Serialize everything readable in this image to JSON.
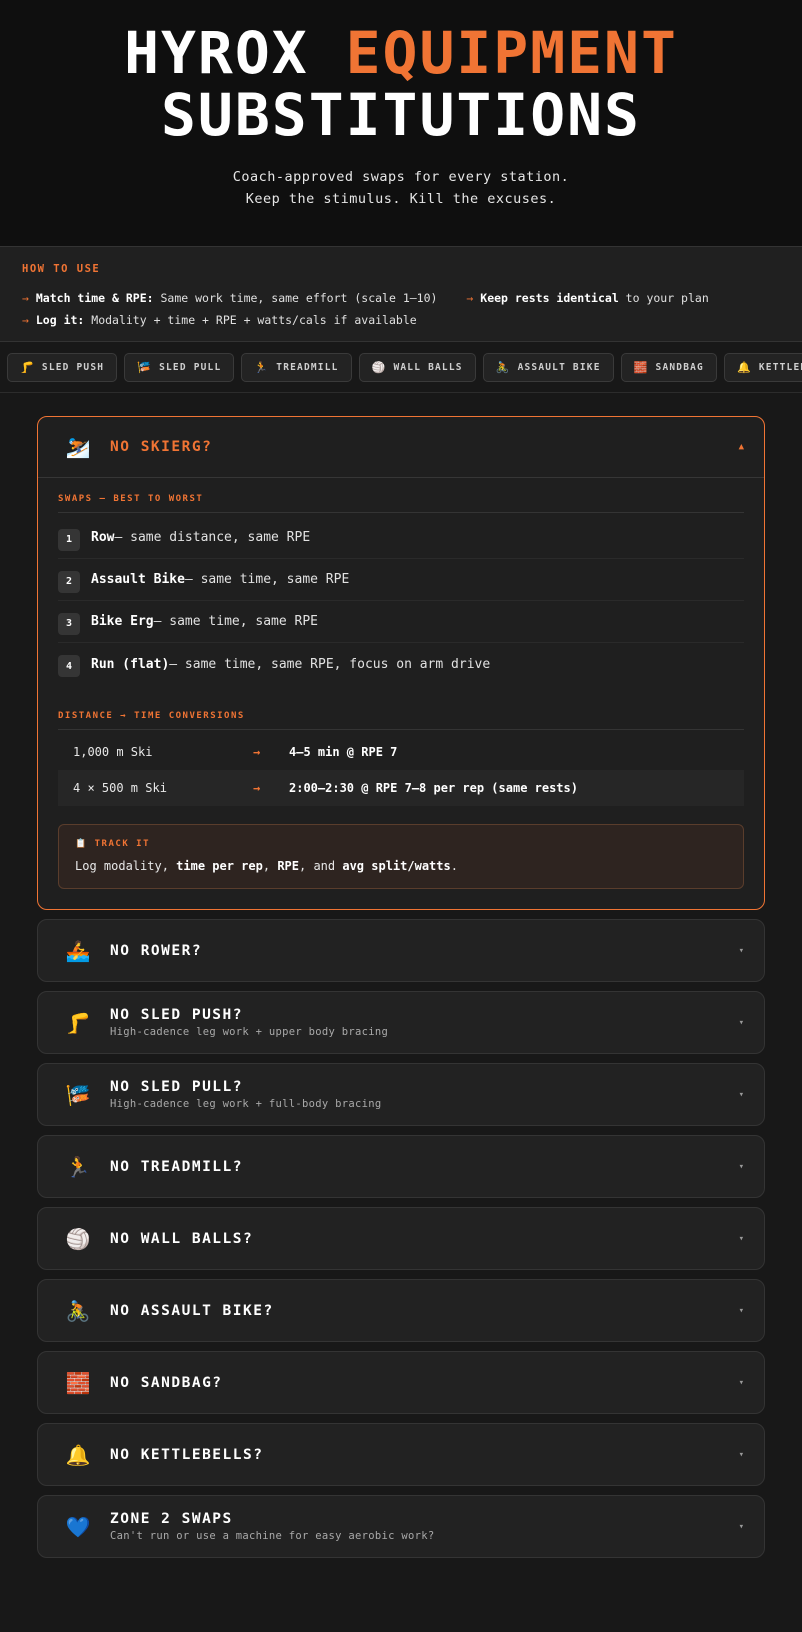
{
  "hero": {
    "title_white": "HYROX",
    "title_accent": "EQUIPMENT",
    "title_line2": "SUBSTITUTIONS",
    "sub_line1": "Coach-approved swaps for every station.",
    "sub_line2": "Keep the stimulus. Kill the excuses."
  },
  "howto": {
    "label": "HOW TO USE",
    "arrow": "→",
    "tip1_bold": "Match time & RPE:",
    "tip1_text": " Same work time, same effort (scale 1–10)",
    "tip2_bold": "Keep rests identical",
    "tip2_text": " to your plan",
    "tip3_bold": "Log it:",
    "tip3_text": " Modality + time + RPE + watts/cals if available"
  },
  "chips": [
    {
      "icon": "🦵",
      "label": "SLED PUSH"
    },
    {
      "icon": "🎏",
      "label": "SLED PULL"
    },
    {
      "icon": "🏃",
      "label": "TREADMILL"
    },
    {
      "icon": "🏐",
      "label": "WALL BALLS"
    },
    {
      "icon": "🚴",
      "label": "ASSAULT BIKE"
    },
    {
      "icon": "🧱",
      "label": "SANDBAG"
    },
    {
      "icon": "🔔",
      "label": "KETTLEBELLS"
    }
  ],
  "open_card": {
    "emoji": "⛷️",
    "title": "NO SKIERG?",
    "chevron": "▲",
    "swaps_label": "SWAPS — BEST TO WORST",
    "swaps": [
      {
        "num": "1",
        "name": "Row",
        "text": " — same distance, same RPE"
      },
      {
        "num": "2",
        "name": "Assault Bike",
        "text": " — same time, same RPE"
      },
      {
        "num": "3",
        "name": "Bike Erg",
        "text": " — same time, same RPE"
      },
      {
        "num": "4",
        "name": "Run (flat)",
        "text": " — same time, same RPE, focus on arm drive"
      }
    ],
    "conv_label": "DISTANCE → TIME CONVERSIONS",
    "conversions": [
      {
        "from": "1,000 m Ski",
        "arrow": "→",
        "to": "4–5 min @ RPE 7"
      },
      {
        "from": "4 × 500 m Ski",
        "arrow": "→",
        "to": "2:00–2:30 @ RPE 7–8 per rep (same rests)"
      }
    ],
    "track": {
      "icon": "📋",
      "label": "TRACK IT",
      "t1": "Log modality, ",
      "b1": "time per rep",
      "t2": ", ",
      "b2": "RPE",
      "t3": ", and ",
      "b3": "avg split/watts",
      "t4": "."
    }
  },
  "cards": [
    {
      "emoji": "🚣",
      "title": "NO ROWER?",
      "desc": "",
      "chevron": "▾"
    },
    {
      "emoji": "🦵",
      "title": "NO SLED PUSH?",
      "desc": "High-cadence leg work + upper body bracing",
      "chevron": "▾"
    },
    {
      "emoji": "🎏",
      "title": "NO SLED PULL?",
      "desc": "High-cadence leg work + full-body bracing",
      "chevron": "▾"
    },
    {
      "emoji": "🏃",
      "title": "NO TREADMILL?",
      "desc": "",
      "chevron": "▾"
    },
    {
      "emoji": "🏐",
      "title": "NO WALL BALLS?",
      "desc": "",
      "chevron": "▾"
    },
    {
      "emoji": "🚴",
      "title": "NO ASSAULT BIKE?",
      "desc": "",
      "chevron": "▾"
    },
    {
      "emoji": "🧱",
      "title": "NO SANDBAG?",
      "desc": "",
      "chevron": "▾"
    },
    {
      "emoji": "🔔",
      "title": "NO KETTLEBELLS?",
      "desc": "",
      "chevron": "▾"
    },
    {
      "emoji": "💙",
      "title": "ZONE 2 SWAPS",
      "desc": "Can't run or use a machine for easy aerobic work?",
      "chevron": "▾"
    }
  ],
  "colors": {
    "accent": "#f07434",
    "background": "#181818",
    "card": "#222222"
  }
}
